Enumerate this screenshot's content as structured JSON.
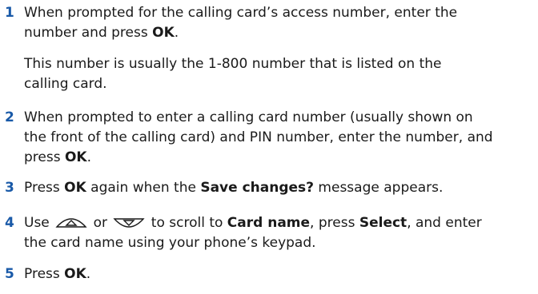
{
  "steps": [
    {
      "number": "1",
      "line1": "When prompted for the calling card’s access number, enter the",
      "line2_pre": "number and press ",
      "line2_key": "OK",
      "line2_post": ".",
      "note_line1": "This number is usually the 1-800 number that is listed on the",
      "note_line2": "calling card."
    },
    {
      "number": "2",
      "line1": "When prompted to enter a calling card number (usually shown on",
      "line2": "the front of the calling card) and PIN number, enter the number, and",
      "line3_pre": "press ",
      "line3_key": "OK",
      "line3_post": "."
    },
    {
      "number": "3",
      "pre": "Press ",
      "key1": "OK",
      "mid": " again when the ",
      "key2": "Save changes?",
      "post": " message appears."
    },
    {
      "number": "4",
      "pre": "Use ",
      "mid": " or ",
      "post1": " to scroll to ",
      "key1": "Card name",
      "post2": ", press ",
      "key2": "Select",
      "post3": ", and enter",
      "line2": "the card name using your phone’s keypad.",
      "icon_up": "scroll-up-key-icon",
      "icon_down": "scroll-down-key-icon"
    },
    {
      "number": "5",
      "pre": "Press ",
      "key": "OK",
      "post": "."
    }
  ],
  "colors": {
    "step_number": "#1a5aa8",
    "text": "#1a1a1a"
  }
}
